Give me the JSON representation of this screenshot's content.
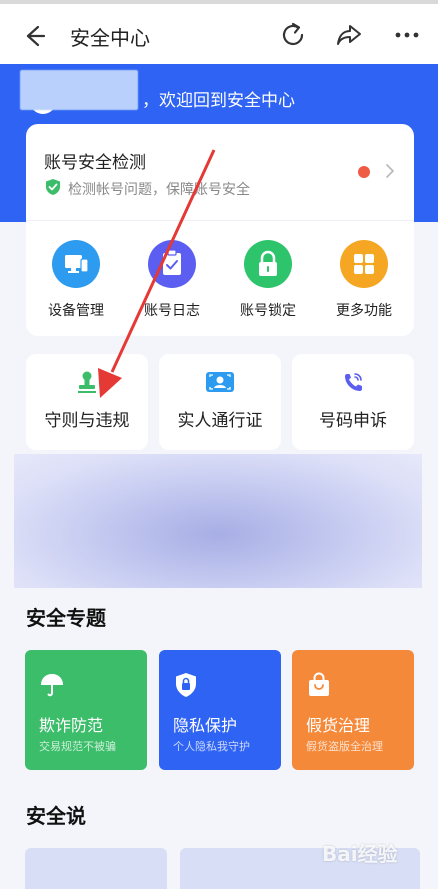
{
  "header": {
    "title": "安全中心",
    "back_icon": "back-arrow-icon",
    "refresh_icon": "refresh-icon",
    "share_icon": "share-icon",
    "more_icon": "more-icon"
  },
  "hero": {
    "welcome": "，欢迎回到安全中心",
    "background": "#2e63f4"
  },
  "security_check": {
    "title": "账号安全检测",
    "subtitle": "检测帐号问题，保障账号安全",
    "status_color": "#f05b45"
  },
  "quick_actions": [
    {
      "label": "设备管理",
      "icon": "device-icon",
      "color": "#2d9bf0"
    },
    {
      "label": "账号日志",
      "icon": "log-icon",
      "color": "#5b5ef0"
    },
    {
      "label": "账号锁定",
      "icon": "lock-icon",
      "color": "#2dc46b"
    },
    {
      "label": "更多功能",
      "icon": "grid-icon",
      "color": "#f5a623"
    }
  ],
  "tiles": [
    {
      "label": "守则与违规",
      "icon": "stamp-icon"
    },
    {
      "label": "实人通行证",
      "icon": "face-id-icon"
    },
    {
      "label": "号码申诉",
      "icon": "phone-icon"
    }
  ],
  "topics_section": {
    "title": "安全专题",
    "items": [
      {
        "name": "欺诈防范",
        "desc": "交易规范不被骗",
        "color": "#3bbd6a",
        "icon": "umbrella-icon"
      },
      {
        "name": "隐私保护",
        "desc": "个人隐私我守护",
        "color": "#2e63f4",
        "icon": "privacy-shield-icon"
      },
      {
        "name": "假货治理",
        "desc": "假货盗版全治理",
        "color": "#f5893a",
        "icon": "shopping-bag-icon"
      }
    ]
  },
  "say_section": {
    "title": "安全说"
  },
  "watermark": "Bai经验"
}
